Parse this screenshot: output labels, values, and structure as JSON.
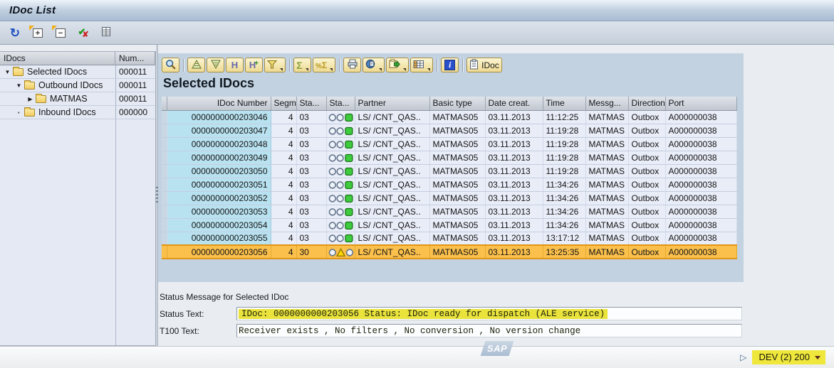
{
  "window": {
    "title": "IDoc List"
  },
  "app_toolbar": {
    "buttons": [
      {
        "name": "refresh",
        "icon": "refresh"
      },
      {
        "name": "expand-all",
        "icon": "expand"
      },
      {
        "name": "collapse-all",
        "icon": "collapse"
      },
      {
        "name": "status-legend",
        "icon": "legend"
      },
      {
        "name": "table-view",
        "icon": "tableview"
      }
    ]
  },
  "tree": {
    "header": {
      "name_col": "IDocs",
      "count_col": "Num..."
    },
    "items": [
      {
        "label": "Selected IDocs",
        "count": "000011",
        "level": 0,
        "state": "open"
      },
      {
        "label": "Outbound IDocs",
        "count": "000011",
        "level": 1,
        "state": "open"
      },
      {
        "label": "MATMAS",
        "count": "000011",
        "level": 2,
        "state": "closed"
      },
      {
        "label": "Inbound IDocs",
        "count": "000000",
        "level": 1,
        "state": "leaf"
      }
    ]
  },
  "alv": {
    "title": "Selected IDocs",
    "toolbar_groups": [
      [
        {
          "name": "details",
          "icon": "magnifier"
        }
      ],
      [
        {
          "name": "sort-ascending",
          "icon": "sortasc"
        },
        {
          "name": "sort-descending",
          "icon": "sortdesc"
        },
        {
          "name": "find",
          "icon": "find"
        },
        {
          "name": "find-next",
          "icon": "findnext"
        },
        {
          "name": "set-filter",
          "icon": "funnel",
          "dropdown": true
        }
      ],
      [
        {
          "name": "total",
          "icon": "sum",
          "dropdown": true
        },
        {
          "name": "subtotals",
          "icon": "subtotal",
          "dropdown": true
        }
      ],
      [
        {
          "name": "print",
          "icon": "print"
        },
        {
          "name": "detail-views",
          "icon": "views",
          "dropdown": true
        },
        {
          "name": "export",
          "icon": "export",
          "dropdown": true
        },
        {
          "name": "choose-layout",
          "icon": "layout",
          "dropdown": true
        }
      ],
      [
        {
          "name": "info",
          "icon": "info"
        }
      ],
      [
        {
          "name": "idoc",
          "icon": "clipboard",
          "label": "IDoc"
        }
      ]
    ],
    "columns": [
      "IDoc Number",
      "Segm...",
      "Sta...",
      "Sta...",
      "Partner",
      "Basic type",
      "Date creat.",
      "Time",
      "Messg...",
      "Direction",
      "Port"
    ],
    "rows": [
      {
        "idoc_number": "0000000000203046",
        "segments": "4",
        "status": "03",
        "light": "green",
        "partner": "LS/ /CNT_QAS..",
        "basic_type": "MATMAS05",
        "date_created": "03.11.2013",
        "time": "11:12:25",
        "message_type": "MATMAS",
        "direction": "Outbox",
        "port": "A000000038",
        "selected": false
      },
      {
        "idoc_number": "0000000000203047",
        "segments": "4",
        "status": "03",
        "light": "green",
        "partner": "LS/ /CNT_QAS..",
        "basic_type": "MATMAS05",
        "date_created": "03.11.2013",
        "time": "11:19:28",
        "message_type": "MATMAS",
        "direction": "Outbox",
        "port": "A000000038",
        "selected": false
      },
      {
        "idoc_number": "0000000000203048",
        "segments": "4",
        "status": "03",
        "light": "green",
        "partner": "LS/ /CNT_QAS..",
        "basic_type": "MATMAS05",
        "date_created": "03.11.2013",
        "time": "11:19:28",
        "message_type": "MATMAS",
        "direction": "Outbox",
        "port": "A000000038",
        "selected": false
      },
      {
        "idoc_number": "0000000000203049",
        "segments": "4",
        "status": "03",
        "light": "green",
        "partner": "LS/ /CNT_QAS..",
        "basic_type": "MATMAS05",
        "date_created": "03.11.2013",
        "time": "11:19:28",
        "message_type": "MATMAS",
        "direction": "Outbox",
        "port": "A000000038",
        "selected": false
      },
      {
        "idoc_number": "0000000000203050",
        "segments": "4",
        "status": "03",
        "light": "green",
        "partner": "LS/ /CNT_QAS..",
        "basic_type": "MATMAS05",
        "date_created": "03.11.2013",
        "time": "11:19:28",
        "message_type": "MATMAS",
        "direction": "Outbox",
        "port": "A000000038",
        "selected": false
      },
      {
        "idoc_number": "0000000000203051",
        "segments": "4",
        "status": "03",
        "light": "green",
        "partner": "LS/ /CNT_QAS..",
        "basic_type": "MATMAS05",
        "date_created": "03.11.2013",
        "time": "11:34:26",
        "message_type": "MATMAS",
        "direction": "Outbox",
        "port": "A000000038",
        "selected": false
      },
      {
        "idoc_number": "0000000000203052",
        "segments": "4",
        "status": "03",
        "light": "green",
        "partner": "LS/ /CNT_QAS..",
        "basic_type": "MATMAS05",
        "date_created": "03.11.2013",
        "time": "11:34:26",
        "message_type": "MATMAS",
        "direction": "Outbox",
        "port": "A000000038",
        "selected": false
      },
      {
        "idoc_number": "0000000000203053",
        "segments": "4",
        "status": "03",
        "light": "green",
        "partner": "LS/ /CNT_QAS..",
        "basic_type": "MATMAS05",
        "date_created": "03.11.2013",
        "time": "11:34:26",
        "message_type": "MATMAS",
        "direction": "Outbox",
        "port": "A000000038",
        "selected": false
      },
      {
        "idoc_number": "0000000000203054",
        "segments": "4",
        "status": "03",
        "light": "green",
        "partner": "LS/ /CNT_QAS..",
        "basic_type": "MATMAS05",
        "date_created": "03.11.2013",
        "time": "11:34:26",
        "message_type": "MATMAS",
        "direction": "Outbox",
        "port": "A000000038",
        "selected": false
      },
      {
        "idoc_number": "0000000000203055",
        "segments": "4",
        "status": "03",
        "light": "green",
        "partner": "LS/ /CNT_QAS..",
        "basic_type": "MATMAS05",
        "date_created": "03.11.2013",
        "time": "13:17:12",
        "message_type": "MATMAS",
        "direction": "Outbox",
        "port": "A000000038",
        "selected": false
      },
      {
        "idoc_number": "0000000000203056",
        "segments": "4",
        "status": "30",
        "light": "yellow",
        "partner": "LS/ /CNT_QAS..",
        "basic_type": "MATMAS05",
        "date_created": "03.11.2013",
        "time": "13:25:35",
        "message_type": "MATMAS",
        "direction": "Outbox",
        "port": "A000000038",
        "selected": true
      }
    ]
  },
  "status_section": {
    "heading": "Status Message for Selected IDoc",
    "status_text_label": "Status Text:",
    "status_text_value": "IDoc: 0000000000203056 Status: IDoc ready for dispatch (ALE service)",
    "t100_label": "T100 Text:",
    "t100_value": "Receiver exists , No filters , No conversion , No version change"
  },
  "status_bar": {
    "logo_text": "SAP",
    "system_field": "DEV (2) 200"
  },
  "colors": {
    "selected_row": "#fbc04c",
    "idoc_number_cell": "#b9e2f0",
    "annotation_highlight": "#e9e33c",
    "green_light": "#3ecb3e",
    "yellow_light": "#ffd800"
  }
}
